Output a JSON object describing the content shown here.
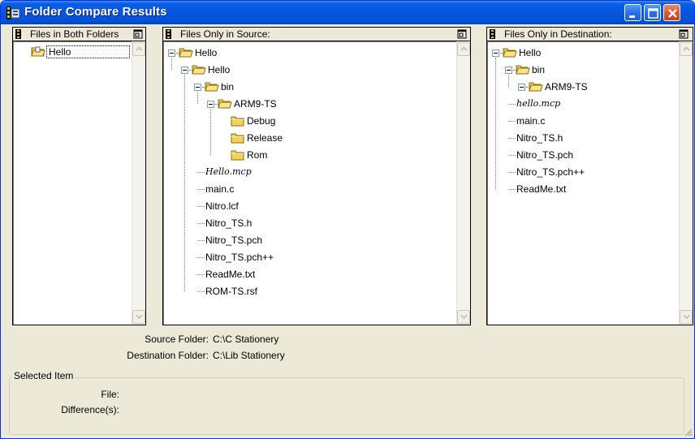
{
  "window": {
    "title": "Folder Compare Results",
    "icon": "folder-compare-icon",
    "buttons": [
      "minimize-icon",
      "maximize-icon",
      "close-icon"
    ]
  },
  "panes": {
    "both": {
      "header": "Files in Both Folders",
      "items": [
        "Hello"
      ]
    },
    "source": {
      "header": "Files Only in Source:",
      "items": [
        "Hello",
        "Hello",
        "bin",
        "ARM9-TS",
        "Debug",
        "Release",
        "Rom",
        "Hello.mcp",
        "main.c",
        "Nitro.lcf",
        "Nitro_TS.h",
        "Nitro_TS.pch",
        "Nitro_TS.pch++",
        "ReadMe.txt",
        "ROM-TS.rsf"
      ]
    },
    "destination": {
      "header": "Files Only in Destination:",
      "items": [
        "Hello",
        "bin",
        "ARM9-TS",
        "hello.mcp",
        "main.c",
        "Nitro_TS.h",
        "Nitro_TS.pch",
        "Nitro_TS.pch++",
        "ReadMe.txt"
      ]
    }
  },
  "info": {
    "source_label": "Source Folder:",
    "source_value": "C:\\C Stationery",
    "dest_label": "Destination Folder:",
    "dest_value": "C:\\Lib Stationery"
  },
  "selected_item": {
    "legend": "Selected Item",
    "file_label": "File:",
    "diff_label": "Difference(s):"
  },
  "colors": {
    "titlebar": "#0655dd",
    "folder": "#f5d15c",
    "selection_border": "#000000"
  }
}
